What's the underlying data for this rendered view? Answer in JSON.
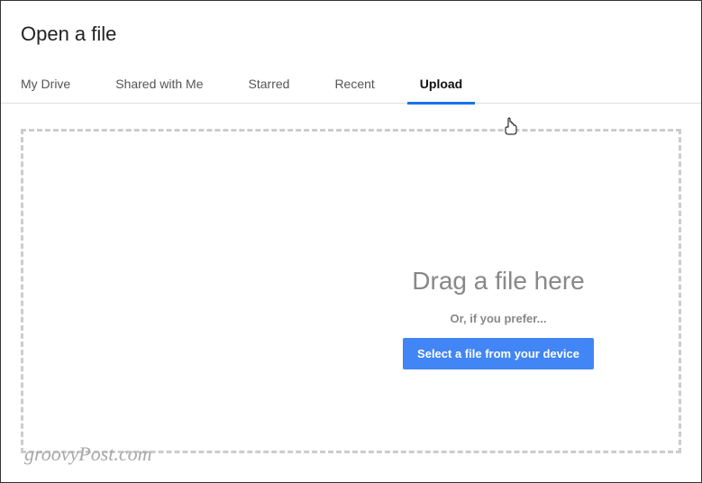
{
  "dialog": {
    "title": "Open a file"
  },
  "tabs": {
    "items": [
      {
        "label": "My Drive"
      },
      {
        "label": "Shared with Me"
      },
      {
        "label": "Starred"
      },
      {
        "label": "Recent"
      },
      {
        "label": "Upload"
      }
    ],
    "active": "Upload"
  },
  "dropzone": {
    "heading": "Drag a file here",
    "subtext": "Or, if you prefer...",
    "button_label": "Select a file from your device"
  },
  "watermark": "groovyPost.com"
}
